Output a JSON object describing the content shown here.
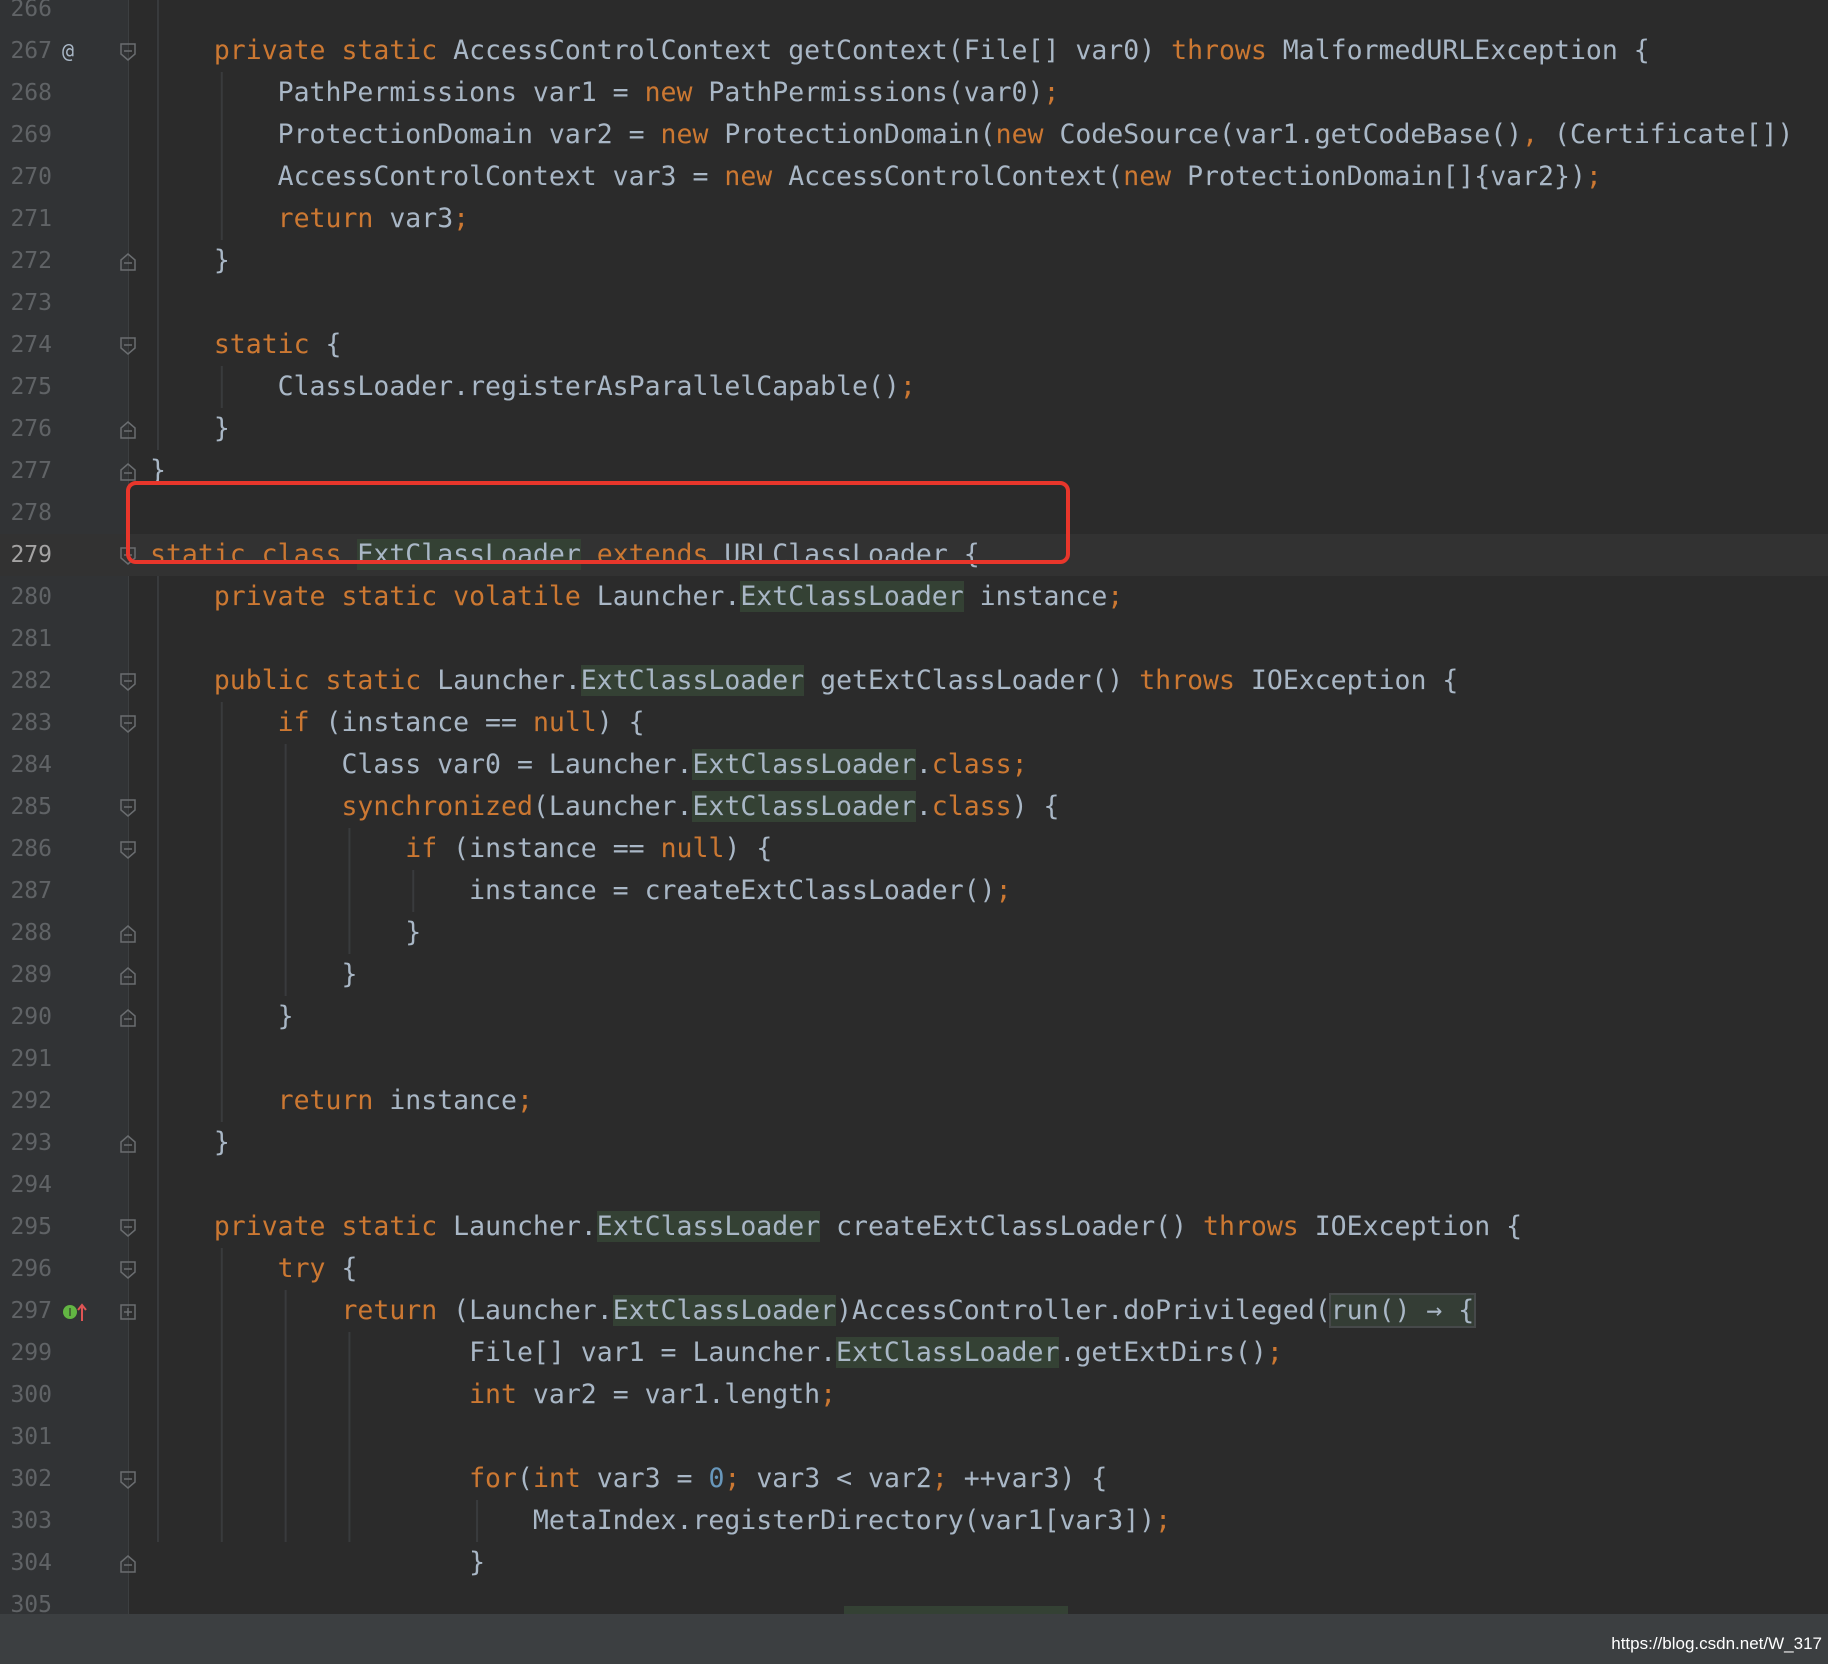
{
  "editor": {
    "lines": [
      {
        "n": "266",
        "fold": "",
        "gutter": "",
        "segs": []
      },
      {
        "n": "267",
        "fold": "start",
        "gutter": "at",
        "segs": [
          [
            "    ",
            ""
          ],
          [
            "private static ",
            "k"
          ],
          [
            "AccessControlContext getContext(File[] var0) ",
            ""
          ],
          [
            "throws ",
            "k"
          ],
          [
            "MalformedURLException {",
            ""
          ]
        ]
      },
      {
        "n": "268",
        "fold": "",
        "gutter": "",
        "segs": [
          [
            "        PathPermissions var1 = ",
            ""
          ],
          [
            "new ",
            "k"
          ],
          [
            "PathPermissions(var0)",
            ""
          ],
          [
            ";",
            "k"
          ]
        ]
      },
      {
        "n": "269",
        "fold": "",
        "gutter": "",
        "segs": [
          [
            "        ProtectionDomain var2 = ",
            ""
          ],
          [
            "new ",
            "k"
          ],
          [
            "ProtectionDomain(",
            ""
          ],
          [
            "new ",
            "k"
          ],
          [
            "CodeSource(var1.getCodeBase()",
            ""
          ],
          [
            ", ",
            "k"
          ],
          [
            "(Certificate[])",
            ""
          ]
        ]
      },
      {
        "n": "270",
        "fold": "",
        "gutter": "",
        "segs": [
          [
            "        AccessControlContext var3 = ",
            ""
          ],
          [
            "new ",
            "k"
          ],
          [
            "AccessControlContext(",
            ""
          ],
          [
            "new ",
            "k"
          ],
          [
            "ProtectionDomain[]{var2})",
            ""
          ],
          [
            ";",
            "k"
          ]
        ]
      },
      {
        "n": "271",
        "fold": "",
        "gutter": "",
        "segs": [
          [
            "        ",
            ""
          ],
          [
            "return ",
            "k"
          ],
          [
            "var3",
            ""
          ],
          [
            ";",
            "k"
          ]
        ]
      },
      {
        "n": "272",
        "fold": "end",
        "gutter": "",
        "segs": [
          [
            "    }",
            ""
          ]
        ]
      },
      {
        "n": "273",
        "fold": "",
        "gutter": "",
        "segs": []
      },
      {
        "n": "274",
        "fold": "start",
        "gutter": "",
        "segs": [
          [
            "    ",
            ""
          ],
          [
            "static ",
            "k"
          ],
          [
            "{",
            ""
          ]
        ]
      },
      {
        "n": "275",
        "fold": "",
        "gutter": "",
        "segs": [
          [
            "        ClassLoader.registerAsParallelCapable()",
            ""
          ],
          [
            ";",
            "k"
          ]
        ]
      },
      {
        "n": "276",
        "fold": "end",
        "gutter": "",
        "segs": [
          [
            "    }",
            ""
          ]
        ]
      },
      {
        "n": "277",
        "fold": "end",
        "gutter": "",
        "segs": [
          [
            "}",
            ""
          ]
        ]
      },
      {
        "n": "278",
        "fold": "",
        "gutter": "",
        "segs": []
      },
      {
        "n": "279",
        "fold": "start",
        "gutter": "",
        "current": true,
        "segs": [
          [
            "static class ",
            "k"
          ],
          [
            "ExtClassLoader",
            "hl"
          ],
          [
            " ",
            ""
          ],
          [
            "extends ",
            "k"
          ],
          [
            "URLClassLoader {",
            ""
          ]
        ]
      },
      {
        "n": "280",
        "fold": "",
        "gutter": "",
        "segs": [
          [
            "    ",
            ""
          ],
          [
            "private static volatile ",
            "k"
          ],
          [
            "Launcher.",
            ""
          ],
          [
            "ExtClassLoader",
            "hl"
          ],
          [
            " instance",
            ""
          ],
          [
            ";",
            "k"
          ]
        ]
      },
      {
        "n": "281",
        "fold": "",
        "gutter": "",
        "segs": []
      },
      {
        "n": "282",
        "fold": "start",
        "gutter": "",
        "segs": [
          [
            "    ",
            ""
          ],
          [
            "public static ",
            "k"
          ],
          [
            "Launcher.",
            ""
          ],
          [
            "ExtClassLoader",
            "hl"
          ],
          [
            " getExtClassLoader() ",
            ""
          ],
          [
            "throws ",
            "k"
          ],
          [
            "IOException {",
            ""
          ]
        ]
      },
      {
        "n": "283",
        "fold": "start",
        "gutter": "",
        "segs": [
          [
            "        ",
            ""
          ],
          [
            "if ",
            "k"
          ],
          [
            "(instance == ",
            ""
          ],
          [
            "null",
            "k"
          ],
          [
            ") {",
            ""
          ]
        ]
      },
      {
        "n": "284",
        "fold": "",
        "gutter": "",
        "segs": [
          [
            "            Class var0 = Launcher.",
            ""
          ],
          [
            "ExtClassLoader",
            "hl"
          ],
          [
            ".",
            ""
          ],
          [
            "class;",
            "k"
          ]
        ]
      },
      {
        "n": "285",
        "fold": "start",
        "gutter": "",
        "segs": [
          [
            "            ",
            ""
          ],
          [
            "synchronized",
            "k"
          ],
          [
            "(Launcher.",
            ""
          ],
          [
            "ExtClassLoader",
            "hl"
          ],
          [
            ".",
            ""
          ],
          [
            "class",
            "k"
          ],
          [
            ") {",
            ""
          ]
        ]
      },
      {
        "n": "286",
        "fold": "start",
        "gutter": "",
        "segs": [
          [
            "                ",
            ""
          ],
          [
            "if ",
            "k"
          ],
          [
            "(instance == ",
            ""
          ],
          [
            "null",
            "k"
          ],
          [
            ") {",
            ""
          ]
        ]
      },
      {
        "n": "287",
        "fold": "",
        "gutter": "",
        "segs": [
          [
            "                    instance = createExtClassLoader()",
            ""
          ],
          [
            ";",
            "k"
          ]
        ]
      },
      {
        "n": "288",
        "fold": "end",
        "gutter": "",
        "segs": [
          [
            "                }",
            ""
          ]
        ]
      },
      {
        "n": "289",
        "fold": "end",
        "gutter": "",
        "segs": [
          [
            "            }",
            ""
          ]
        ]
      },
      {
        "n": "290",
        "fold": "end",
        "gutter": "",
        "segs": [
          [
            "        }",
            ""
          ]
        ]
      },
      {
        "n": "291",
        "fold": "",
        "gutter": "",
        "segs": []
      },
      {
        "n": "292",
        "fold": "",
        "gutter": "",
        "segs": [
          [
            "        ",
            ""
          ],
          [
            "return ",
            "k"
          ],
          [
            "instance",
            ""
          ],
          [
            ";",
            "k"
          ]
        ]
      },
      {
        "n": "293",
        "fold": "end",
        "gutter": "",
        "segs": [
          [
            "    }",
            ""
          ]
        ]
      },
      {
        "n": "294",
        "fold": "",
        "gutter": "",
        "segs": []
      },
      {
        "n": "295",
        "fold": "start",
        "gutter": "",
        "segs": [
          [
            "    ",
            ""
          ],
          [
            "private static ",
            "k"
          ],
          [
            "Launcher.",
            ""
          ],
          [
            "ExtClassLoader",
            "hl"
          ],
          [
            " createExtClassLoader() ",
            ""
          ],
          [
            "throws ",
            "k"
          ],
          [
            "IOException {",
            ""
          ]
        ]
      },
      {
        "n": "296",
        "fold": "start",
        "gutter": "",
        "segs": [
          [
            "        ",
            ""
          ],
          [
            "try ",
            "k"
          ],
          [
            "{",
            ""
          ]
        ]
      },
      {
        "n": "297",
        "fold": "plus",
        "gutter": "impl",
        "segs": [
          [
            "            ",
            ""
          ],
          [
            "return ",
            "k"
          ],
          [
            "(Launcher.",
            ""
          ],
          [
            "ExtClassLoader",
            "hl"
          ],
          [
            ")AccessController.doPrivileged(",
            ""
          ],
          [
            "run() → {",
            "lbox"
          ]
        ]
      },
      {
        "n": "299",
        "fold": "",
        "gutter": "",
        "segs": [
          [
            "                    File[] var1 = Launcher.",
            ""
          ],
          [
            "ExtClassLoader",
            "hl"
          ],
          [
            ".getExtDirs()",
            ""
          ],
          [
            ";",
            "k"
          ]
        ]
      },
      {
        "n": "300",
        "fold": "",
        "gutter": "",
        "segs": [
          [
            "                    ",
            ""
          ],
          [
            "int ",
            "k"
          ],
          [
            "var2 = var1.length",
            ""
          ],
          [
            ";",
            "k"
          ]
        ]
      },
      {
        "n": "301",
        "fold": "",
        "gutter": "",
        "segs": []
      },
      {
        "n": "302",
        "fold": "start",
        "gutter": "",
        "segs": [
          [
            "                    ",
            ""
          ],
          [
            "for",
            "k"
          ],
          [
            "(",
            ""
          ],
          [
            "int ",
            "k"
          ],
          [
            "var3 = ",
            ""
          ],
          [
            "0",
            "n"
          ],
          [
            "; ",
            "k"
          ],
          [
            "var3 < var2",
            ""
          ],
          [
            "; ",
            "k"
          ],
          [
            "++var3) {",
            ""
          ]
        ]
      },
      {
        "n": "303",
        "fold": "",
        "gutter": "",
        "segs": [
          [
            "                        MetaIndex.registerDirectory(var1[var3])",
            ""
          ],
          [
            ";",
            "k"
          ]
        ]
      },
      {
        "n": "304",
        "fold": "end",
        "gutter": "",
        "segs": [
          [
            "                    }",
            ""
          ]
        ]
      },
      {
        "n": "305",
        "fold": "",
        "gutter": "",
        "segs": []
      }
    ]
  },
  "gutter_icons": {
    "at": "@",
    "impl": "implementation-icon"
  },
  "statusbar": {
    "watermark": "https://blog.csdn.net/W_317"
  },
  "colors": {
    "background": "#2b2b2b",
    "keyword": "#cc7832",
    "text": "#a9b7c6",
    "number": "#6897bb",
    "highlight": "#344134",
    "annotation_box": "#e8362b"
  }
}
